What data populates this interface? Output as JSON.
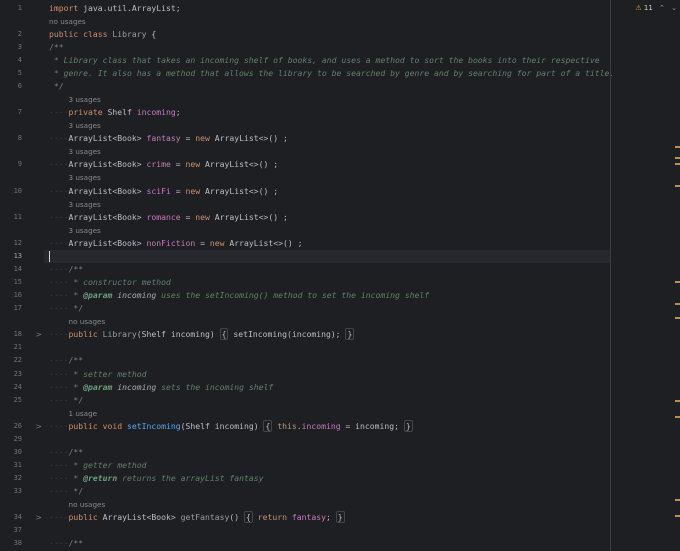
{
  "inspections": {
    "icon": "warning-triangle-icon",
    "symbol": "⚠",
    "count": "11",
    "prev_symbol": "⌃",
    "next_symbol": "⌄"
  },
  "lines": [
    {
      "type": "code",
      "ln": "1",
      "indent": 0,
      "seg": [
        {
          "c": "kw",
          "t": "import "
        },
        {
          "c": "",
          "t": "java.util.ArrayList;"
        }
      ]
    },
    {
      "type": "hint",
      "indent": 0,
      "text": "no usages"
    },
    {
      "type": "code",
      "ln": "2",
      "indent": 0,
      "seg": [
        {
          "c": "kw",
          "t": "public class "
        },
        {
          "c": "dim",
          "t": "Library"
        },
        {
          "c": "",
          "t": " {"
        }
      ]
    },
    {
      "type": "code",
      "ln": "3",
      "indent": 0,
      "seg": [
        {
          "c": "cmt",
          "t": "/**"
        }
      ]
    },
    {
      "type": "code",
      "ln": "4",
      "indent": 0,
      "seg": [
        {
          "c": "doc",
          "t": " * Library class that takes an incoming shelf of books, and uses a method to sort the books into their respective"
        }
      ]
    },
    {
      "type": "code",
      "ln": "5",
      "indent": 0,
      "seg": [
        {
          "c": "doc",
          "t": " * genre. It also has a method that allows the library to be searched by genre and by searching for part of a title."
        }
      ]
    },
    {
      "type": "code",
      "ln": "6",
      "indent": 0,
      "seg": [
        {
          "c": "cmt",
          "t": " */"
        }
      ]
    },
    {
      "type": "hint",
      "indent": 1,
      "text": "3 usages"
    },
    {
      "type": "code",
      "ln": "7",
      "indent": 1,
      "seg": [
        {
          "c": "kw",
          "t": "private "
        },
        {
          "c": "",
          "t": "Shelf "
        },
        {
          "c": "fld",
          "t": "incoming"
        },
        {
          "c": "",
          "t": ";"
        }
      ]
    },
    {
      "type": "hint",
      "indent": 1,
      "text": "3 usages"
    },
    {
      "type": "code",
      "ln": "8",
      "indent": 1,
      "seg": [
        {
          "c": "",
          "t": "ArrayList<Book> "
        },
        {
          "c": "fld",
          "t": "fantasy"
        },
        {
          "c": "",
          "t": " = "
        },
        {
          "c": "kw",
          "t": "new "
        },
        {
          "c": "",
          "t": "ArrayList<>() ;"
        }
      ]
    },
    {
      "type": "hint",
      "indent": 1,
      "text": "3 usages"
    },
    {
      "type": "code",
      "ln": "9",
      "indent": 1,
      "seg": [
        {
          "c": "",
          "t": "ArrayList<Book> "
        },
        {
          "c": "fld",
          "t": "crime"
        },
        {
          "c": "",
          "t": " = "
        },
        {
          "c": "kw",
          "t": "new "
        },
        {
          "c": "",
          "t": "ArrayList<>() ;"
        }
      ]
    },
    {
      "type": "hint",
      "indent": 1,
      "text": "3 usages"
    },
    {
      "type": "code",
      "ln": "10",
      "indent": 1,
      "seg": [
        {
          "c": "",
          "t": "ArrayList<Book> "
        },
        {
          "c": "fld",
          "t": "sciFi"
        },
        {
          "c": "",
          "t": " = "
        },
        {
          "c": "kw",
          "t": "new "
        },
        {
          "c": "",
          "t": "ArrayList<>() ;"
        }
      ]
    },
    {
      "type": "hint",
      "indent": 1,
      "text": "3 usages"
    },
    {
      "type": "code",
      "ln": "11",
      "indent": 1,
      "seg": [
        {
          "c": "",
          "t": "ArrayList<Book> "
        },
        {
          "c": "fld",
          "t": "romance"
        },
        {
          "c": "",
          "t": " = "
        },
        {
          "c": "kw",
          "t": "new "
        },
        {
          "c": "",
          "t": "ArrayList<>() ;"
        }
      ]
    },
    {
      "type": "hint",
      "indent": 1,
      "text": "3 usages"
    },
    {
      "type": "code",
      "ln": "12",
      "indent": 1,
      "seg": [
        {
          "c": "",
          "t": "ArrayList<Book> "
        },
        {
          "c": "fld",
          "t": "nonFiction"
        },
        {
          "c": "",
          "t": " = "
        },
        {
          "c": "kw",
          "t": "new "
        },
        {
          "c": "",
          "t": "ArrayList<>() ;"
        }
      ]
    },
    {
      "type": "code",
      "ln": "13",
      "indent": 0,
      "current": true,
      "seg": []
    },
    {
      "type": "code",
      "ln": "14",
      "indent": 1,
      "seg": [
        {
          "c": "cmt",
          "t": "/**"
        }
      ]
    },
    {
      "type": "code",
      "ln": "15",
      "indent": 1,
      "seg": [
        {
          "c": "doc",
          "t": " * constructor method"
        }
      ]
    },
    {
      "type": "code",
      "ln": "16",
      "indent": 1,
      "seg": [
        {
          "c": "doc",
          "t": " * "
        },
        {
          "c": "tag",
          "t": "@param"
        },
        {
          "c": "docp",
          "t": " incoming"
        },
        {
          "c": "doc",
          "t": " uses the setIncoming() method to set the incoming shelf"
        }
      ]
    },
    {
      "type": "code",
      "ln": "17",
      "indent": 1,
      "seg": [
        {
          "c": "cmt",
          "t": " */"
        }
      ]
    },
    {
      "type": "hint",
      "indent": 1,
      "text": "no usages"
    },
    {
      "type": "code",
      "ln": "18",
      "indent": 1,
      "fold": ">",
      "seg": [
        {
          "c": "kw",
          "t": "public "
        },
        {
          "c": "dim",
          "t": "Library"
        },
        {
          "c": "",
          "t": "(Shelf incoming) "
        },
        {
          "c": "fb",
          "t": "{"
        },
        {
          "c": "",
          "t": " setIncoming(incoming); "
        },
        {
          "c": "fb",
          "t": "}"
        }
      ]
    },
    {
      "type": "blank",
      "ln": "21"
    },
    {
      "type": "code",
      "ln": "22",
      "indent": 1,
      "seg": [
        {
          "c": "cmt",
          "t": "/**"
        }
      ]
    },
    {
      "type": "code",
      "ln": "23",
      "indent": 1,
      "seg": [
        {
          "c": "doc",
          "t": " * setter method"
        }
      ]
    },
    {
      "type": "code",
      "ln": "24",
      "indent": 1,
      "seg": [
        {
          "c": "doc",
          "t": " * "
        },
        {
          "c": "tag",
          "t": "@param"
        },
        {
          "c": "docp",
          "t": " incoming"
        },
        {
          "c": "doc",
          "t": " sets the incoming shelf"
        }
      ]
    },
    {
      "type": "code",
      "ln": "25",
      "indent": 1,
      "seg": [
        {
          "c": "cmt",
          "t": " */"
        }
      ]
    },
    {
      "type": "hint",
      "indent": 1,
      "text": "1 usage"
    },
    {
      "type": "code",
      "ln": "26",
      "indent": 1,
      "fold": ">",
      "seg": [
        {
          "c": "kw",
          "t": "public void "
        },
        {
          "c": "mth",
          "t": "setIncoming"
        },
        {
          "c": "",
          "t": "(Shelf incoming) "
        },
        {
          "c": "fb",
          "t": "{"
        },
        {
          "c": "",
          "t": " "
        },
        {
          "c": "kw",
          "t": "this"
        },
        {
          "c": "",
          "t": "."
        },
        {
          "c": "fld",
          "t": "incoming"
        },
        {
          "c": "",
          "t": " = incoming; "
        },
        {
          "c": "fb",
          "t": "}"
        }
      ]
    },
    {
      "type": "blank",
      "ln": "29"
    },
    {
      "type": "code",
      "ln": "30",
      "indent": 1,
      "seg": [
        {
          "c": "cmt",
          "t": "/**"
        }
      ]
    },
    {
      "type": "code",
      "ln": "31",
      "indent": 1,
      "seg": [
        {
          "c": "doc",
          "t": " * getter method"
        }
      ]
    },
    {
      "type": "code",
      "ln": "32",
      "indent": 1,
      "seg": [
        {
          "c": "doc",
          "t": " * "
        },
        {
          "c": "tag",
          "t": "@return"
        },
        {
          "c": "doc",
          "t": " returns the arrayList fantasy"
        }
      ]
    },
    {
      "type": "code",
      "ln": "33",
      "indent": 1,
      "seg": [
        {
          "c": "cmt",
          "t": " */"
        }
      ]
    },
    {
      "type": "hint",
      "indent": 1,
      "text": "no usages"
    },
    {
      "type": "code",
      "ln": "34",
      "indent": 1,
      "fold": ">",
      "seg": [
        {
          "c": "kw",
          "t": "public "
        },
        {
          "c": "",
          "t": "ArrayList<Book> "
        },
        {
          "c": "dim",
          "t": "getFantasy"
        },
        {
          "c": "",
          "t": "() "
        },
        {
          "c": "fb",
          "t": "{"
        },
        {
          "c": "",
          "t": " "
        },
        {
          "c": "kw",
          "t": "return "
        },
        {
          "c": "fld",
          "t": "fantasy"
        },
        {
          "c": "",
          "t": "; "
        },
        {
          "c": "fb",
          "t": "}"
        }
      ]
    },
    {
      "type": "blank",
      "ln": "37"
    },
    {
      "type": "code",
      "ln": "38",
      "indent": 1,
      "seg": [
        {
          "c": "cmt",
          "t": "/**"
        }
      ]
    }
  ]
}
